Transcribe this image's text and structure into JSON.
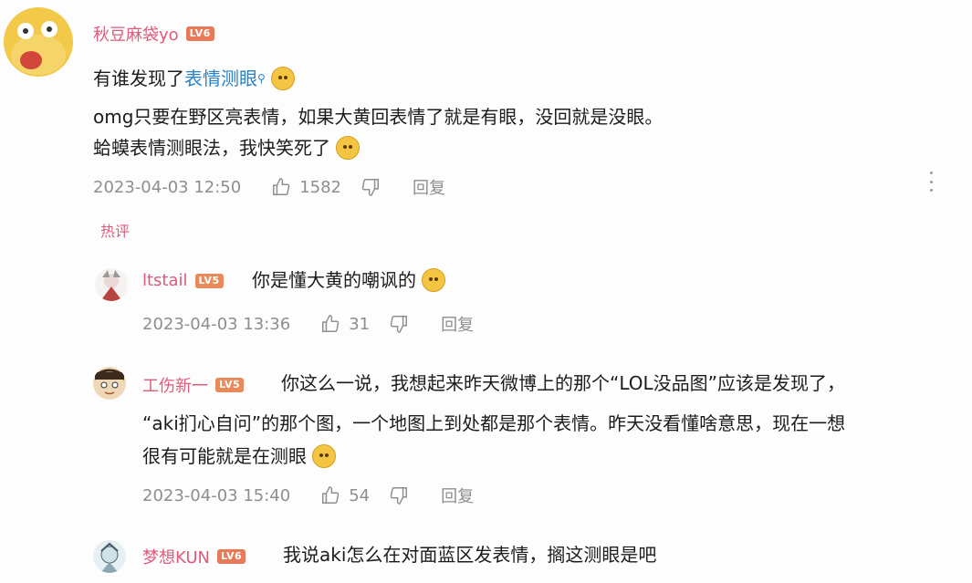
{
  "main_comment": {
    "username": "秋豆麻袋yo",
    "level": "LV6",
    "line1_prefix": "有谁发现了",
    "line1_hashtag": "表情测眼",
    "line2": "omg只要在野区亮表情，如果大黄回表情了就是有眼，没回就是没眼。",
    "line3": "蛤蟆表情测眼法，我快笑死了",
    "timestamp": "2023-04-03 12:50",
    "likes": "1582",
    "reply_label": "回复"
  },
  "hot_label": "热评",
  "replies": [
    {
      "username": "ltstail",
      "level": "LV5",
      "text": "你是懂大黄的嘲讽的",
      "timestamp": "2023-04-03 13:36",
      "likes": "31",
      "reply_label": "回复"
    },
    {
      "username": "工伤新一",
      "level": "LV5",
      "text_line1": "你这么一说，我想起来昨天微博上的那个“LOL没品图”应该是发现了，",
      "text_line2": "“aki扪心自问”的那个图，一个地图上到处都是那个表情。昨天没看懂啥意思，现在一想",
      "text_line3": "很有可能就是在测眼",
      "timestamp": "2023-04-03 15:40",
      "likes": "54",
      "reply_label": "回复"
    },
    {
      "username": "梦想KUN",
      "level": "LV6",
      "text": "我说aki怎么在对面蓝区发表情，搁这测眼是吧"
    }
  ],
  "icons": {
    "like": "thumbs-up-icon",
    "dislike": "thumbs-down-icon",
    "more": "more-vertical-icon"
  }
}
